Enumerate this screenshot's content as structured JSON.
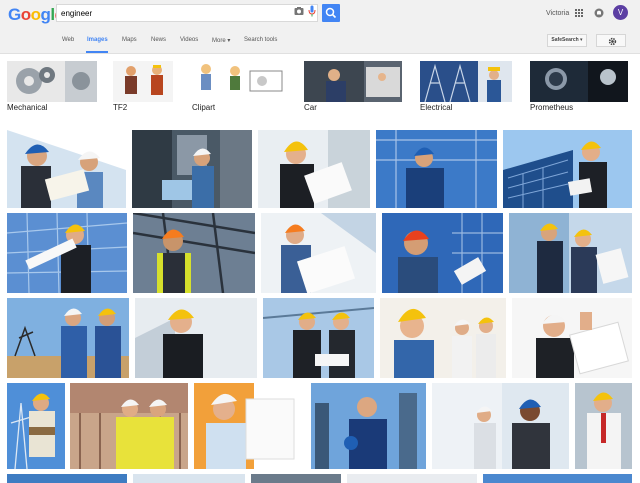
{
  "header": {
    "logo": "Google",
    "query": "engineer",
    "user_name": "Victoria",
    "avatar_letter": "V"
  },
  "tabs": [
    {
      "label": "Web"
    },
    {
      "label": "Images"
    },
    {
      "label": "Maps"
    },
    {
      "label": "News"
    },
    {
      "label": "Videos"
    },
    {
      "label": "More ▾"
    },
    {
      "label": "Search tools"
    }
  ],
  "toolbar": {
    "safesearch_label": "SafeSearch ▾"
  },
  "related_searches": [
    {
      "label": "Mechanical"
    },
    {
      "label": "TF2"
    },
    {
      "label": "Clipart"
    },
    {
      "label": "Car"
    },
    {
      "label": "Electrical"
    },
    {
      "label": "Prometheus"
    }
  ],
  "colors": {
    "blue": "#4285f4",
    "red": "#ea4335",
    "yellow": "#fbbc05",
    "green": "#34a853",
    "helmet_yellow": "#f4c20d",
    "helmet_white": "#f5f5f5",
    "helmet_orange": "#f57c1f",
    "helmet_blue": "#1f5fb4"
  }
}
